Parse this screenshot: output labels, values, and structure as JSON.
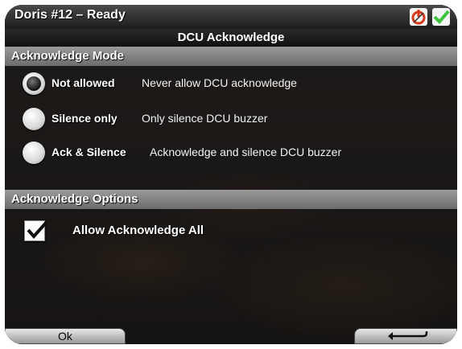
{
  "title_bar": {
    "title": "Doris #12 – Ready",
    "icons": [
      "power-icon",
      "check-icon"
    ]
  },
  "header": {
    "title": "DCU Acknowledge"
  },
  "sections": {
    "mode": {
      "title": "Acknowledge Mode"
    },
    "options": {
      "title": "Acknowledge Options"
    }
  },
  "mode_options": [
    {
      "label": "Not allowed",
      "desc": "Never allow DCU acknowledge",
      "selected": true
    },
    {
      "label": "Silence only",
      "desc": "Only silence DCU buzzer",
      "selected": false
    },
    {
      "label": "Ack & Silence",
      "desc": "Acknowledge and silence DCU buzzer",
      "selected": false
    }
  ],
  "allow_all": {
    "label": "Allow Acknowledge All",
    "checked": true
  },
  "softkeys": {
    "left": "Ok",
    "right_icon": "return-arrow-icon"
  },
  "colors": {
    "check_green": "#3cc23c",
    "power_red": "#d63a1a"
  }
}
